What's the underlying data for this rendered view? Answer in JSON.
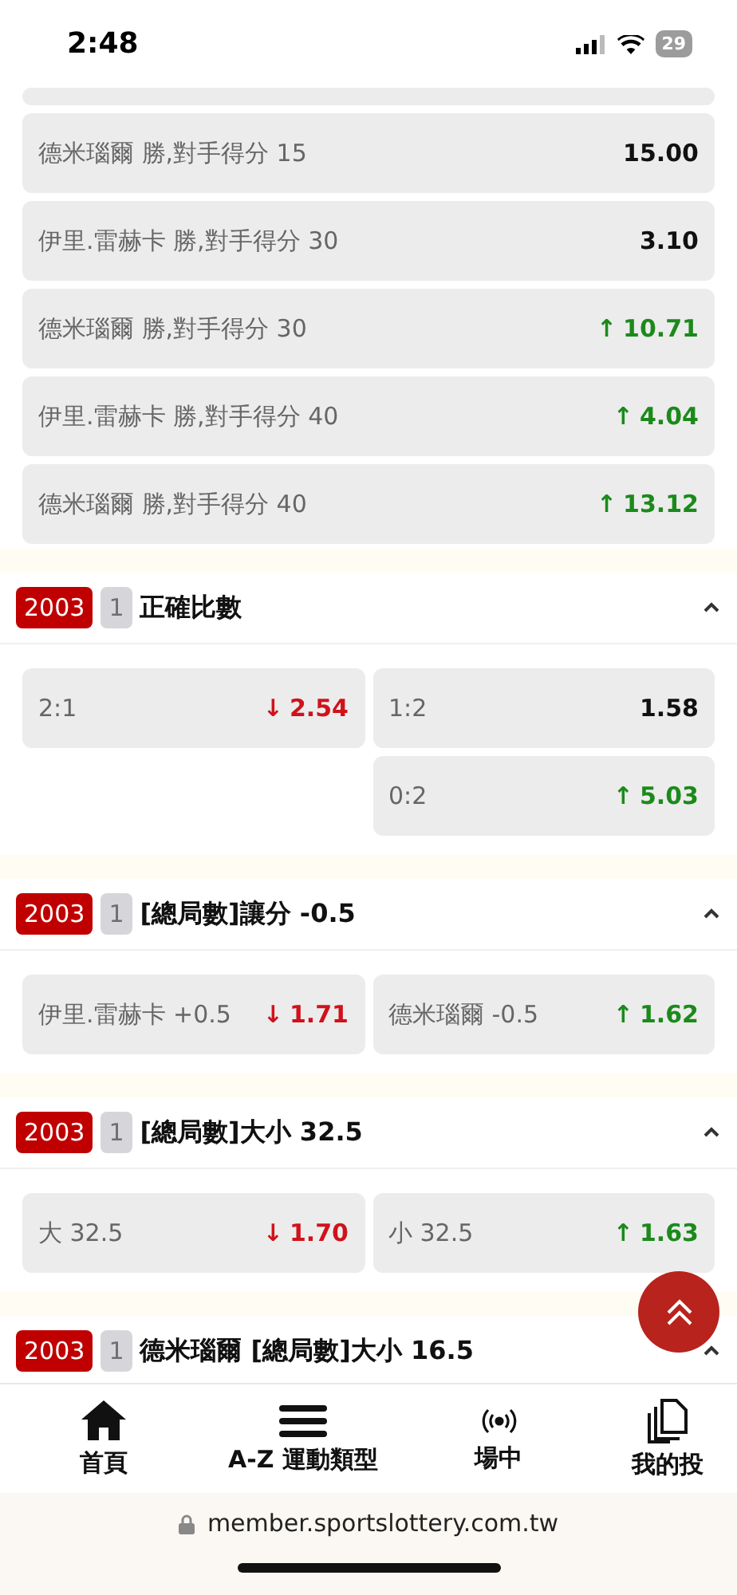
{
  "status_bar": {
    "time": "2:48",
    "battery": "29"
  },
  "top_options": [
    {
      "kind": "partial"
    },
    {
      "kind": "option",
      "label": "德米瑙爾 勝,對手得分 15",
      "odds": "15.00",
      "color": "#111111"
    },
    {
      "kind": "option",
      "label": "伊里.雷赫卡 勝,對手得分 30",
      "odds": "3.10",
      "color": "#111111"
    },
    {
      "kind": "option",
      "label": "德米瑙爾 勝,對手得分 30",
      "arrow": "↑",
      "odds": "10.71",
      "color": "#1b8a1b"
    },
    {
      "kind": "option",
      "label": "伊里.雷赫卡 勝,對手得分 40",
      "arrow": "↑",
      "odds": "4.04",
      "color": "#1b8a1b"
    },
    {
      "kind": "option",
      "label": "德米瑙爾 勝,對手得分 40",
      "arrow": "↑",
      "odds": "13.12",
      "color": "#1b8a1b"
    }
  ],
  "markets": [
    {
      "code": "2003",
      "number": "1",
      "title": "正確比數",
      "expanded": true,
      "rows": [
        [
          {
            "kind": "option",
            "label": "2:1",
            "arrow": "↓",
            "odds": "2.54",
            "color": "#d0121b"
          },
          {
            "kind": "option",
            "label": "1:2",
            "odds": "1.58",
            "color": "#111111"
          }
        ],
        [
          {
            "kind": "blank"
          },
          {
            "kind": "option",
            "label": "0:2",
            "arrow": "↑",
            "odds": "5.03",
            "color": "#1b8a1b"
          }
        ]
      ]
    },
    {
      "code": "2003",
      "number": "1",
      "title": "[總局數]讓分 -0.5",
      "expanded": true,
      "rows": [
        [
          {
            "kind": "option",
            "label": "伊里.雷赫卡 +0.5",
            "arrow": "↓",
            "odds": "1.71",
            "color": "#d0121b"
          },
          {
            "kind": "option",
            "label": "德米瑙爾 -0.5",
            "arrow": "↑",
            "odds": "1.62",
            "color": "#1b8a1b"
          }
        ]
      ]
    },
    {
      "code": "2003",
      "number": "1",
      "title": "[總局數]大小 32.5",
      "expanded": true,
      "rows": [
        [
          {
            "kind": "option",
            "label": "大 32.5",
            "arrow": "↓",
            "odds": "1.70",
            "color": "#d0121b"
          },
          {
            "kind": "option",
            "label": "小 32.5",
            "arrow": "↑",
            "odds": "1.63",
            "color": "#1b8a1b"
          }
        ]
      ]
    },
    {
      "code": "2003",
      "number": "1",
      "title": "德米瑙爾 [總局數]大小 16.5",
      "expanded": true
    }
  ],
  "bottom_nav": [
    {
      "kind": "home",
      "label": "首頁"
    },
    {
      "kind": "menu",
      "label": "A-Z 運動類型"
    },
    {
      "kind": "live",
      "label": "場中"
    },
    {
      "kind": "bets",
      "label": "我的投"
    }
  ],
  "browser": {
    "url": "member.sportslottery.com.tw"
  }
}
